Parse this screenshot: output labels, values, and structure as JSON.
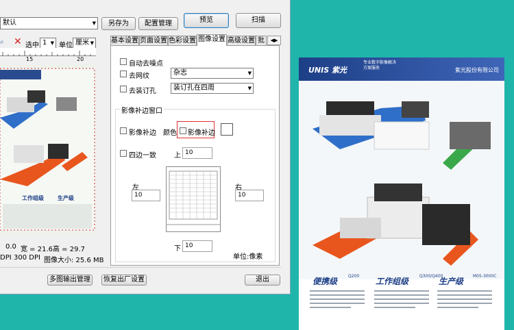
{
  "toolbar": {
    "profile_value": "默认",
    "save_as_label": "另存为",
    "config_mgmt_label": "配置管理",
    "preview_label": "预览",
    "scan_label": "扫描"
  },
  "preview_bar": {
    "select_label": "选中",
    "page_value": "1",
    "unit_label": "单位",
    "unit_value": "厘米",
    "ruler_ticks": [
      "15",
      "20"
    ]
  },
  "tabs": [
    {
      "label": "基本设置"
    },
    {
      "label": "页面设置"
    },
    {
      "label": "色彩设置"
    },
    {
      "label": "图像设置",
      "active": true
    },
    {
      "label": "高级设置"
    },
    {
      "label": "批"
    }
  ],
  "image_settings": {
    "denoise_label": "自动去噪点",
    "demoire_label": "去网纹",
    "demoire_value": "杂志",
    "remove_holes_label": "去装订孔",
    "remove_holes_value": "装订孔在四周",
    "fill_window_title": "影像补边窗口",
    "fill_label": "影像补边",
    "color_label": "颜色",
    "fill_check_label": "影像补边",
    "uniform_label": "四边一致",
    "top_label": "上",
    "top_value": "10",
    "left_label": "左",
    "left_value": "10",
    "right_label": "右",
    "right_value": "10",
    "bottom_label": "下",
    "bottom_value": "10",
    "unit_note": "单位:像素"
  },
  "status": {
    "x_partial": "0.0",
    "width_text": "宽 = 21.6",
    "height_text": "高 = 29.7",
    "dpi_partial": "DPI",
    "dpi_text": "300 DPI",
    "size_text": "图像大小: 25.6 MB"
  },
  "footer": {
    "multi_output_label": "多图输出管理",
    "restore_label": "恢复出厂设置",
    "exit_label": "退出"
  },
  "document": {
    "brand": "UNIS 紫光",
    "tagline": "专业数字影像解决方案服务",
    "company": "紫光股份有限公司",
    "section1_title": "便携级",
    "section1_sub": "Q200",
    "section2_title": "工作组级",
    "section2_sub": "Q300/Q400",
    "section3_title": "生产级",
    "section3_sub": "M05-3000C"
  },
  "colors": {
    "background": "#1fb5ab",
    "dialog": "#f0f0f0",
    "highlight": "#e03030",
    "doc_header": "#1d3f86",
    "arrow_blue": "#2f6fc9",
    "arrow_orange": "#e8561e",
    "arrow_green": "#3aa84a"
  }
}
